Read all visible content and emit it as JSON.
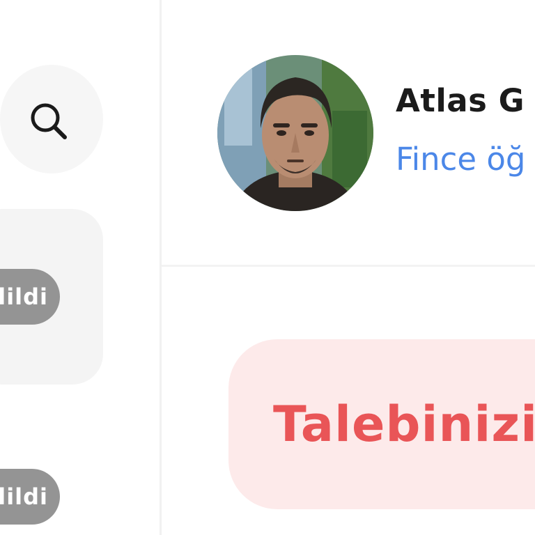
{
  "sidebar": {
    "search_icon": "search-icon",
    "conversations": [
      {
        "status": "dildi"
      },
      {
        "status": "dildi"
      }
    ]
  },
  "header": {
    "user_name": "Atlas G",
    "user_role": "Fince öğ"
  },
  "request_banner": {
    "text": "Talebinizi"
  },
  "colors": {
    "accent_blue": "#4b87e8",
    "alert_red": "#e95557",
    "alert_bg": "#fdeaea",
    "badge_grey": "#949494"
  }
}
